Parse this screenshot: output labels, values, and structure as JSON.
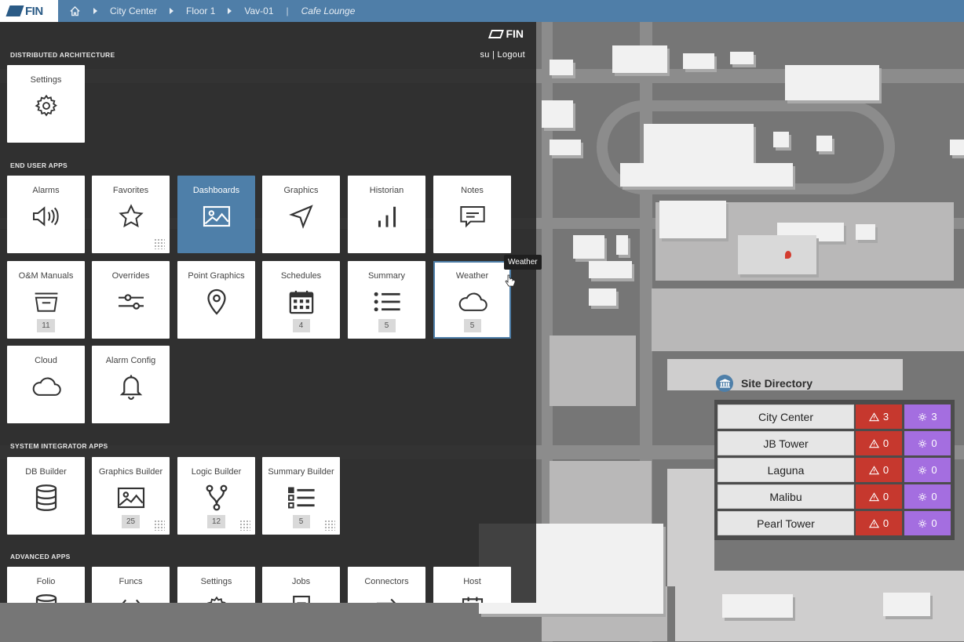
{
  "topbar": {
    "logo": "FIN",
    "breadcrumbs": [
      "City Center",
      "Floor 1",
      "Vav-01"
    ],
    "current": "Cafe Lounge"
  },
  "panel": {
    "brand": "FIN",
    "user": "su",
    "logout": "Logout",
    "sections": {
      "distributed": "DISTRIBUTED ARCHITECTURE",
      "end_user": "END USER APPS",
      "system_integrator": "SYSTEM INTEGRATOR APPS",
      "advanced": "ADVANCED APPS"
    },
    "distributed_apps": [
      {
        "label": "Settings",
        "icon": "gear-icon"
      }
    ],
    "end_user_apps": [
      {
        "label": "Alarms",
        "icon": "speaker-icon"
      },
      {
        "label": "Favorites",
        "icon": "star-icon"
      },
      {
        "label": "Dashboards",
        "icon": "image-icon"
      },
      {
        "label": "Graphics",
        "icon": "navigation-arrow-icon"
      },
      {
        "label": "Historian",
        "icon": "bar-chart-icon"
      },
      {
        "label": "Notes",
        "icon": "comment-icon"
      },
      {
        "label": "O&M Manuals",
        "icon": "inbox-icon",
        "badge": "11"
      },
      {
        "label": "Overrides",
        "icon": "sliders-icon"
      },
      {
        "label": "Point Graphics",
        "icon": "map-pin-icon"
      },
      {
        "label": "Schedules",
        "icon": "calendar-icon",
        "badge": "4"
      },
      {
        "label": "Summary",
        "icon": "list-icon",
        "badge": "5"
      },
      {
        "label": "Weather",
        "icon": "cloud-icon",
        "badge": "5"
      },
      {
        "label": "Cloud",
        "icon": "cloud-icon"
      },
      {
        "label": "Alarm Config",
        "icon": "bell-icon"
      }
    ],
    "system_integrator_apps": [
      {
        "label": "DB Builder",
        "icon": "database-icon"
      },
      {
        "label": "Graphics Builder",
        "icon": "image-icon",
        "badge": "25"
      },
      {
        "label": "Logic Builder",
        "icon": "branch-icon",
        "badge": "12"
      },
      {
        "label": "Summary Builder",
        "icon": "checklist-icon",
        "badge": "5"
      }
    ],
    "advanced_apps": [
      {
        "label": "Folio"
      },
      {
        "label": "Funcs"
      },
      {
        "label": "Settings"
      },
      {
        "label": "Jobs"
      },
      {
        "label": "Connectors"
      },
      {
        "label": "Host"
      }
    ],
    "tooltip": "Weather"
  },
  "site_directory": {
    "title": "Site Directory",
    "sites": [
      {
        "name": "City Center",
        "alarms": "3",
        "sparks": "3"
      },
      {
        "name": "JB Tower",
        "alarms": "0",
        "sparks": "0"
      },
      {
        "name": "Laguna",
        "alarms": "0",
        "sparks": "0"
      },
      {
        "name": "Malibu",
        "alarms": "0",
        "sparks": "0"
      },
      {
        "name": "Pearl Tower",
        "alarms": "0",
        "sparks": "0"
      }
    ]
  },
  "colors": {
    "accent": "#4e7fa9",
    "alarm": "#c6382e",
    "spark": "#a46ee0"
  }
}
